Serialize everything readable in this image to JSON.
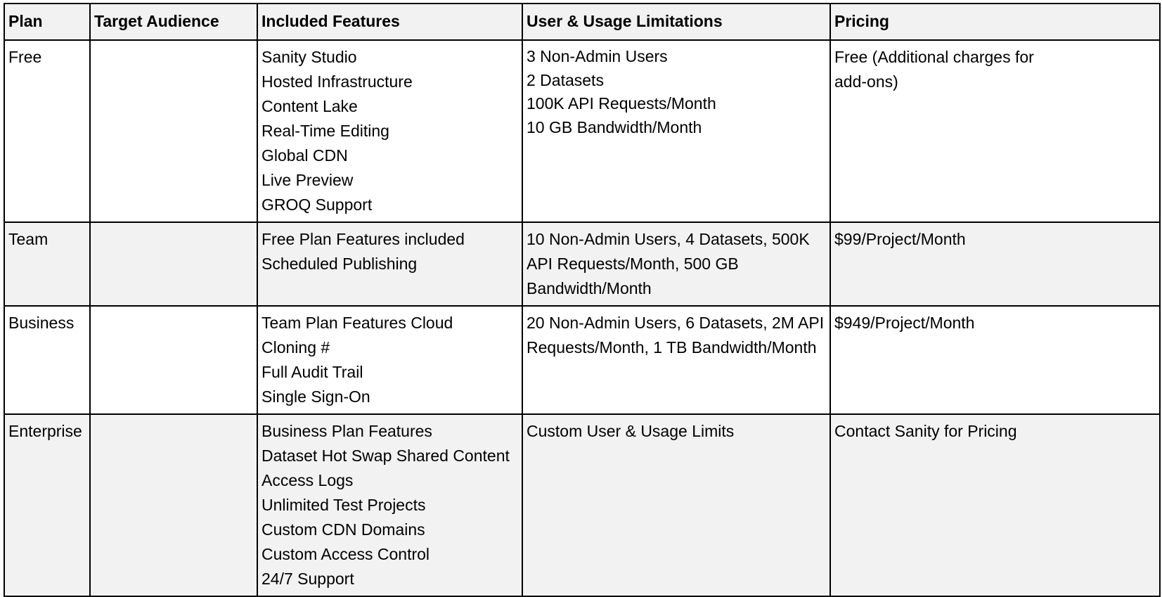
{
  "table": {
    "headers": [
      "Plan",
      "Target Audience",
      "Included Features",
      "User & Usage Limitations",
      "Pricing"
    ],
    "rows": [
      {
        "plan": "Free",
        "audience": "",
        "features": [
          "Sanity Studio",
          "Hosted Infrastructure",
          "Content Lake",
          "Real-Time Editing",
          "Global CDN",
          "Live Preview",
          "GROQ Support"
        ],
        "limits": [
          "3 Non-Admin Users",
          "2 Datasets",
          "100K API Requests/Month",
          "10 GB Bandwidth/Month"
        ],
        "pricing": "Free (Additional charges for add-ons)"
      },
      {
        "plan": "Team",
        "audience": "",
        "features": [
          "Free Plan Features included",
          "Scheduled Publishing"
        ],
        "limits": "10 Non-Admin Users, 4 Datasets, 500K API Requests/Month, 500 GB Bandwidth/Month",
        "pricing": "$99/Project/Month"
      },
      {
        "plan": "Business",
        "audience": "",
        "features": [
          "Team Plan Features Cloud",
          "Cloning #",
          "Full Audit Trail",
          "Single Sign-On"
        ],
        "limits": "20 Non-Admin Users, 6 Datasets, 2M API Requests/Month, 1 TB Bandwidth/Month",
        "pricing": "$949/Project/Month"
      },
      {
        "plan": "Enterprise",
        "audience": "",
        "features": [
          "Business Plan Features",
          "Dataset Hot Swap Shared Content",
          "Access Logs",
          "Unlimited Test Projects",
          "Custom CDN Domains",
          "Custom Access Control",
          "24/7 Support"
        ],
        "limits": "Custom User & Usage Limits",
        "pricing": "Contact Sanity for Pricing"
      }
    ]
  },
  "colors": {
    "border": "#000000",
    "header_bg": "#f2f2f2",
    "alt_row_bg": "#f2f2f2",
    "row_bg": "#ffffff"
  }
}
